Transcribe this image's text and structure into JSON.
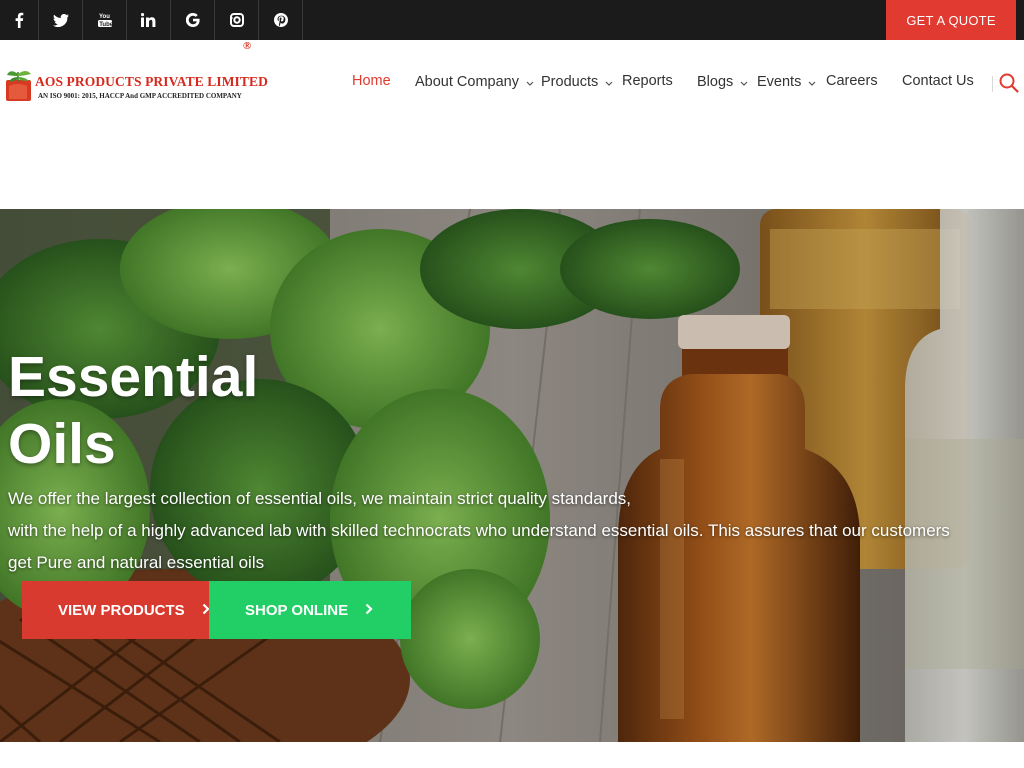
{
  "topbar": {
    "social": [
      {
        "icon": "facebook-icon",
        "glyph": "f"
      },
      {
        "icon": "twitter-icon",
        "glyph": "bird"
      },
      {
        "icon": "youtube-icon",
        "glyph": "You Tube"
      },
      {
        "icon": "linkedin-icon",
        "glyph": "in"
      },
      {
        "icon": "google-icon",
        "glyph": "G"
      },
      {
        "icon": "instagram-icon",
        "glyph": "camera"
      },
      {
        "icon": "pinterest-icon",
        "glyph": "p"
      }
    ],
    "quote_label": "GET A QUOTE"
  },
  "header": {
    "logo_name": "AOS PRODUCTS PRIVATE LIMITED",
    "logo_reg": "®",
    "logo_sub": "AN ISO 9001: 2015, HACCP And GMP ACCREDITED COMPANY",
    "nav": [
      {
        "label": "Home",
        "active": true,
        "dropdown": false
      },
      {
        "label": "About Company",
        "active": false,
        "dropdown": true
      },
      {
        "label": "Products",
        "active": false,
        "dropdown": true
      },
      {
        "label": "Reports",
        "active": false,
        "dropdown": false
      },
      {
        "label": "Blogs",
        "active": false,
        "dropdown": true
      },
      {
        "label": "Events",
        "active": false,
        "dropdown": true
      },
      {
        "label": "Careers",
        "active": false,
        "dropdown": false
      },
      {
        "label": "Contact Us",
        "active": false,
        "dropdown": false
      }
    ]
  },
  "hero": {
    "title_line1": "Essential",
    "title_line2": "Oils",
    "text_line1": "We offer the largest collection of essential oils, we maintain strict quality standards,",
    "text_line2": "with the help of a highly advanced lab with skilled technocrats who understand essential oils. This assures that our customers",
    "text_line3": "get Pure and natural essential oils",
    "view_products_label": "VIEW PRODUCTS",
    "shop_online_label": "SHOP ONLINE"
  },
  "colors": {
    "accent_red": "#e03a31",
    "green_button": "#22cf66",
    "topbar_bg": "#1b1b1b"
  }
}
